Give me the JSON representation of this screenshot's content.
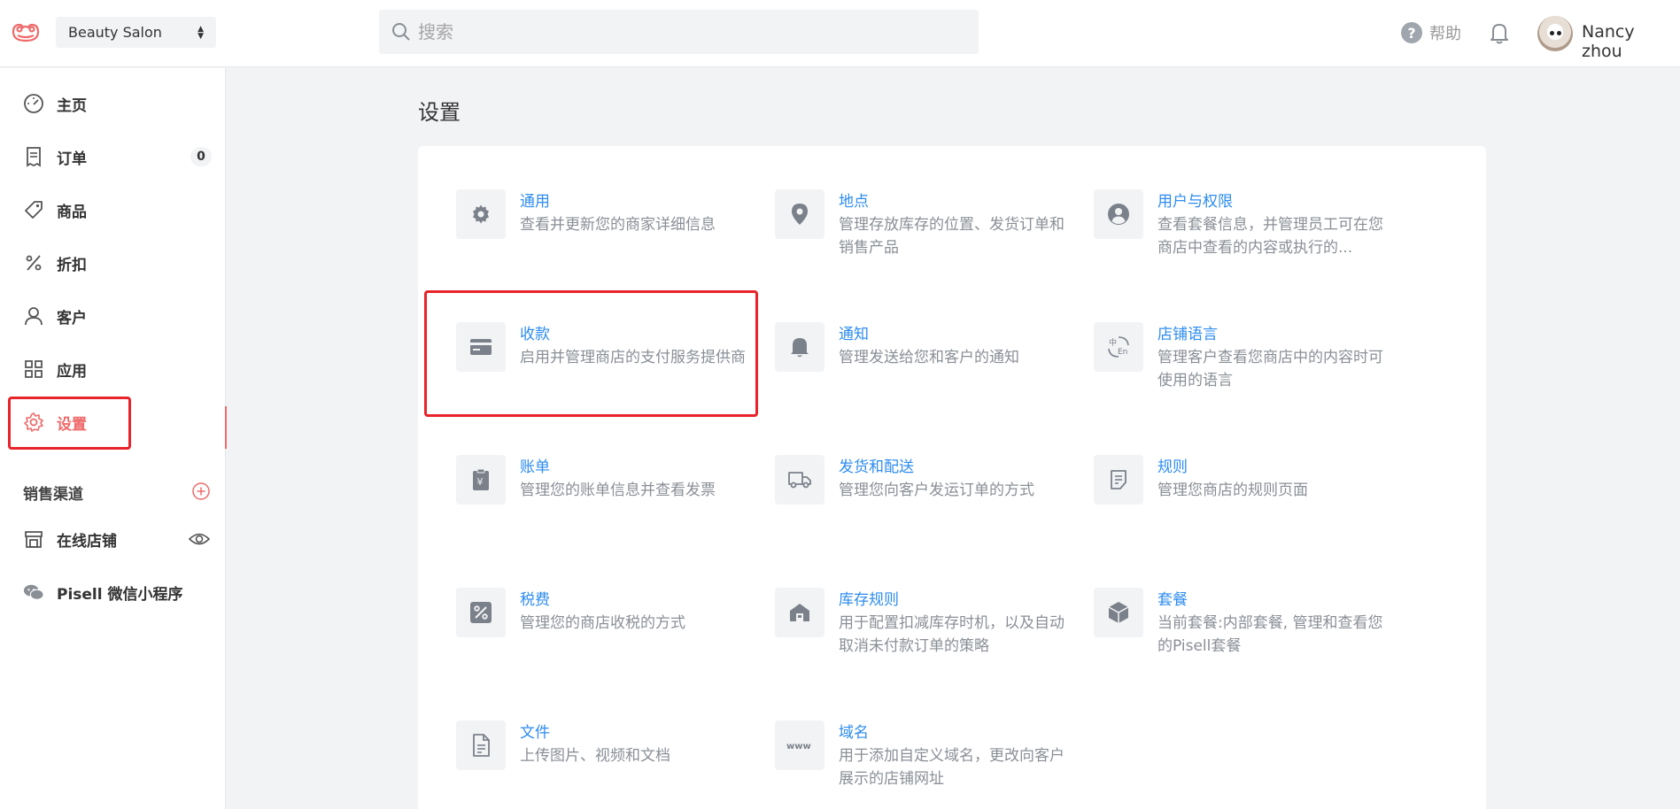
{
  "topbar": {
    "store_name": "Beauty Salon",
    "search_placeholder": "搜索",
    "help_label": "帮助",
    "username": "Nancy zhou"
  },
  "sidebar": {
    "items": [
      {
        "label": "主页",
        "icon": "dashboard-icon"
      },
      {
        "label": "订单",
        "icon": "orders-icon",
        "badge": "0"
      },
      {
        "label": "商品",
        "icon": "tag-icon"
      },
      {
        "label": "折扣",
        "icon": "percent-icon"
      },
      {
        "label": "客户",
        "icon": "user-icon"
      },
      {
        "label": "应用",
        "icon": "apps-icon"
      },
      {
        "label": "设置",
        "icon": "gear-icon",
        "active": true
      }
    ],
    "section_title": "销售渠道",
    "channels": [
      {
        "label": "在线店铺",
        "icon": "store-icon"
      },
      {
        "label": "Pisell 微信小程序",
        "icon": "wechat-icon"
      }
    ]
  },
  "main": {
    "title": "设置",
    "settings": [
      {
        "title": "通用",
        "desc": "查看并更新您的商家详细信息",
        "icon": "gear-icon"
      },
      {
        "title": "地点",
        "desc": "管理存放库存的位置、发货订单和销售产品",
        "icon": "location-icon"
      },
      {
        "title": "用户与权限",
        "desc": "查看套餐信息，并管理员工可在您商店中查看的内容或执行的...",
        "icon": "user-circle-icon"
      },
      {
        "title": "收款",
        "desc": "启用并管理商店的支付服务提供商",
        "icon": "credit-card-icon"
      },
      {
        "title": "通知",
        "desc": "管理发送给您和客户的通知",
        "icon": "bell-icon"
      },
      {
        "title": "店铺语言",
        "desc": "管理客户查看您商店中的内容时可使用的语言",
        "icon": "language-icon"
      },
      {
        "title": "账单",
        "desc": "管理您的账单信息并查看发票",
        "icon": "bill-icon"
      },
      {
        "title": "发货和配送",
        "desc": "管理您向客户发运订单的方式",
        "icon": "truck-icon"
      },
      {
        "title": "规则",
        "desc": "管理您商店的规则页面",
        "icon": "rules-icon"
      },
      {
        "title": "税费",
        "desc": "管理您的商店收税的方式",
        "icon": "tax-icon"
      },
      {
        "title": "库存规则",
        "desc": "用于配置扣减库存时机，以及自动取消未付款订单的策略",
        "icon": "warehouse-icon"
      },
      {
        "title": "套餐",
        "desc": "当前套餐:内部套餐, 管理和查看您的Pisell套餐",
        "icon": "package-icon"
      },
      {
        "title": "文件",
        "desc": "上传图片、视频和文档",
        "icon": "file-icon"
      },
      {
        "title": "域名",
        "desc": "用于添加自定义域名，更改向客户展示的店铺网址",
        "icon": "www-icon"
      }
    ]
  },
  "colors": {
    "accent": "#ef6a6a",
    "link": "#2d8cf0",
    "highlight_box": "#e8232a"
  }
}
